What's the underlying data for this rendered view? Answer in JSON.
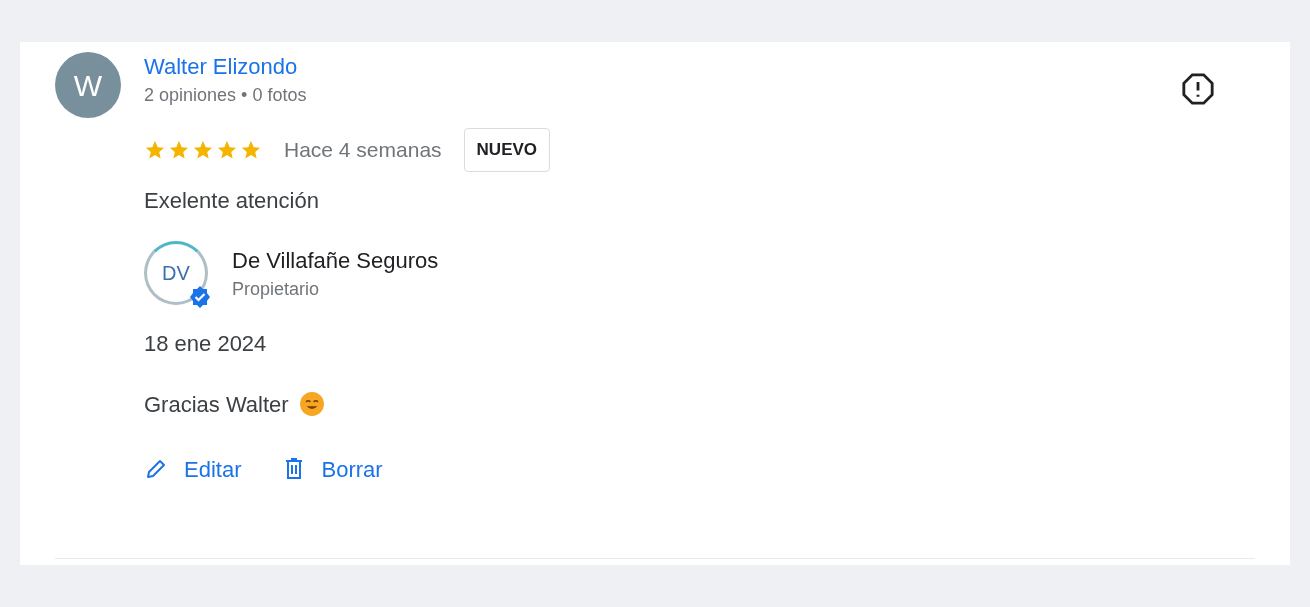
{
  "review": {
    "avatar_letter": "W",
    "author": "Walter Elizondo",
    "author_meta": "2 opiniones • 0 fotos",
    "stars": 5,
    "time": "Hace 4 semanas",
    "badge": "NUEVO",
    "text": "Exelente atención"
  },
  "owner_reply": {
    "logo_text": "DV",
    "verified": true,
    "name": "De Villafañe Seguros",
    "role": "Propietario",
    "date": "18 ene 2024",
    "text": "Gracias Walter"
  },
  "actions": [
    {
      "kind": "edit",
      "label": "Editar"
    },
    {
      "kind": "delete",
      "label": "Borrar"
    }
  ]
}
